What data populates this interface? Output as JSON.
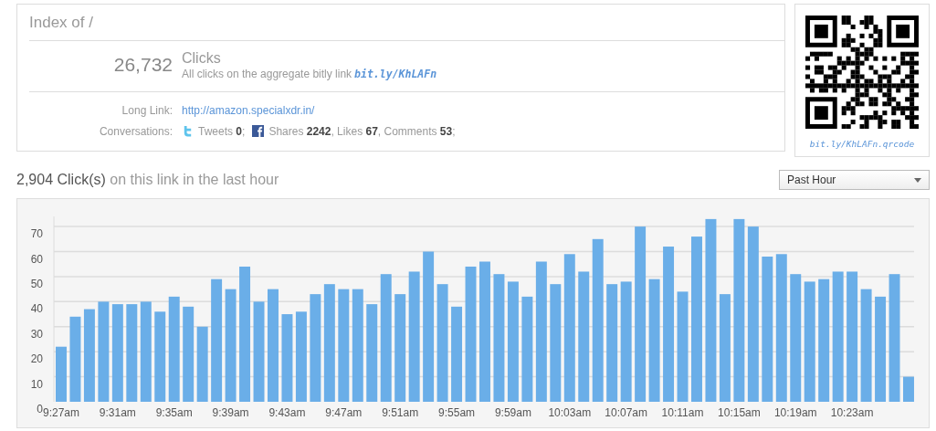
{
  "header": {
    "title": "Index of /"
  },
  "stats": {
    "count": "26,732",
    "label": "Clicks",
    "description": "All clicks on the aggregate bitly link",
    "link": "bit.ly/KhLAFn"
  },
  "details": [
    {
      "label": "Long Link:",
      "kind": "link",
      "value": "http://amazon.specialxdr.in/"
    },
    {
      "label": "Conversations:",
      "kind": "social",
      "items": [
        {
          "kind": "twitter",
          "text": "Tweets **0**;"
        },
        {
          "kind": "facebook",
          "text": "Shares **2242**, Likes **67**, Comments **53**;"
        }
      ]
    }
  ],
  "qr": {
    "caption": "bit.ly/KhLAFn.qrcode"
  },
  "summary": {
    "count": "2,904 Click(s)",
    "text": "on this link in the last hour"
  },
  "range_select": {
    "value": "Past Hour"
  },
  "chart_data": {
    "type": "bar",
    "grid": true,
    "ylim": [
      0,
      74
    ],
    "yticks": [
      0,
      10,
      20,
      30,
      40,
      50,
      60,
      70
    ],
    "categories": [
      "9:27am",
      null,
      null,
      null,
      "9:31am",
      null,
      null,
      null,
      "9:35am",
      null,
      null,
      null,
      "9:39am",
      null,
      null,
      null,
      "9:43am",
      null,
      null,
      null,
      "9:47am",
      null,
      null,
      null,
      "9:51am",
      null,
      null,
      null,
      "9:55am",
      null,
      null,
      null,
      "9:59am",
      null,
      null,
      null,
      "10:03am",
      null,
      null,
      null,
      "10:07am",
      null,
      null,
      null,
      "10:11am",
      null,
      null,
      null,
      "10:15am",
      null,
      null,
      null,
      "10:19am",
      null,
      null,
      null,
      "10:23am",
      null,
      null,
      null,
      null
    ],
    "series": [
      {
        "color": "#6aaee8",
        "values": [
          22,
          34,
          37,
          40,
          39,
          39,
          40,
          36,
          42,
          38,
          30,
          49,
          45,
          54,
          40,
          45,
          35,
          36,
          43,
          47,
          45,
          45,
          39,
          51,
          43,
          52,
          60,
          47,
          38,
          54,
          56,
          51,
          48,
          42,
          56,
          47,
          59,
          52,
          65,
          47,
          48,
          70,
          49,
          62,
          44,
          66,
          73,
          43,
          73,
          70,
          58,
          59,
          51,
          48,
          49,
          52,
          52,
          45,
          42,
          51,
          10
        ]
      }
    ]
  }
}
